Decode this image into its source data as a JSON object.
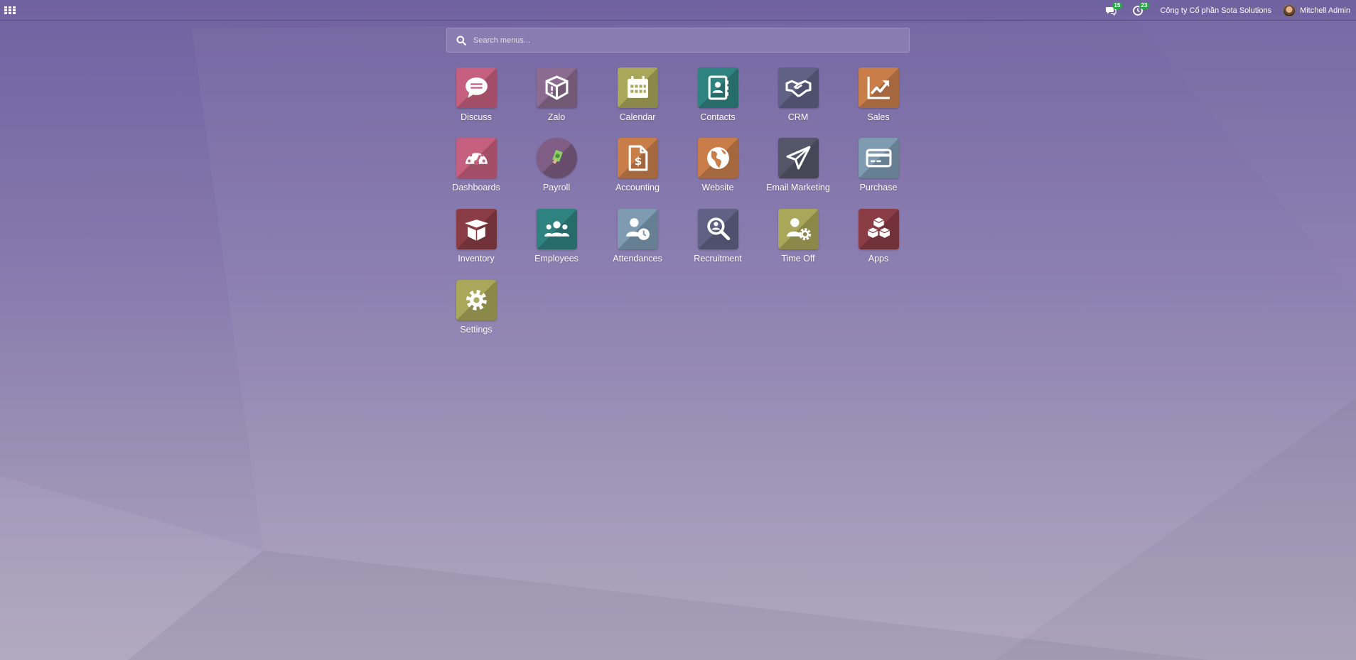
{
  "topbar": {
    "discuss_count": "15",
    "activity_count": "23",
    "company": "Công ty Cổ phần Sota Solutions",
    "user_name": "Mitchell Admin"
  },
  "search": {
    "placeholder": "Search menus..."
  },
  "apps": [
    {
      "label": "Discuss",
      "icon": "chat-bubble-icon",
      "color": "#c55f80"
    },
    {
      "label": "Zalo",
      "icon": "package-icon",
      "color": "#8b6b8f"
    },
    {
      "label": "Calendar",
      "icon": "calendar-icon",
      "color": "#a9a75a"
    },
    {
      "label": "Contacts",
      "icon": "address-book-icon",
      "color": "#2e8381"
    },
    {
      "label": "CRM",
      "icon": "handshake-icon",
      "color": "#5f6285"
    },
    {
      "label": "Sales",
      "icon": "trend-chart-icon",
      "color": "#c97e4a"
    },
    {
      "label": "Dashboards",
      "icon": "speedometer-icon",
      "color": "#c55f80"
    },
    {
      "label": "Payroll",
      "icon": "cash-icon",
      "color": "#7f5d84"
    },
    {
      "label": "Accounting",
      "icon": "invoice-dollar-icon",
      "color": "#c97e4a"
    },
    {
      "label": "Website",
      "icon": "globe-icon",
      "color": "#c97e4a"
    },
    {
      "label": "Email Marketing",
      "icon": "paper-plane-icon",
      "color": "#55556a"
    },
    {
      "label": "Purchase",
      "icon": "credit-card-icon",
      "color": "#7e9bb2"
    },
    {
      "label": "Inventory",
      "icon": "open-box-icon",
      "color": "#8a3c45"
    },
    {
      "label": "Employees",
      "icon": "users-icon",
      "color": "#2e8381"
    },
    {
      "label": "Attendances",
      "icon": "user-clock-icon",
      "color": "#7e9bb2"
    },
    {
      "label": "Recruitment",
      "icon": "magnifier-icon",
      "color": "#5f6285"
    },
    {
      "label": "Time Off",
      "icon": "user-gear-icon",
      "color": "#a9a75a"
    },
    {
      "label": "Apps",
      "icon": "cubes-icon",
      "color": "#8a3c45"
    },
    {
      "label": "Settings",
      "icon": "gear-icon",
      "color": "#a9a75a"
    }
  ]
}
